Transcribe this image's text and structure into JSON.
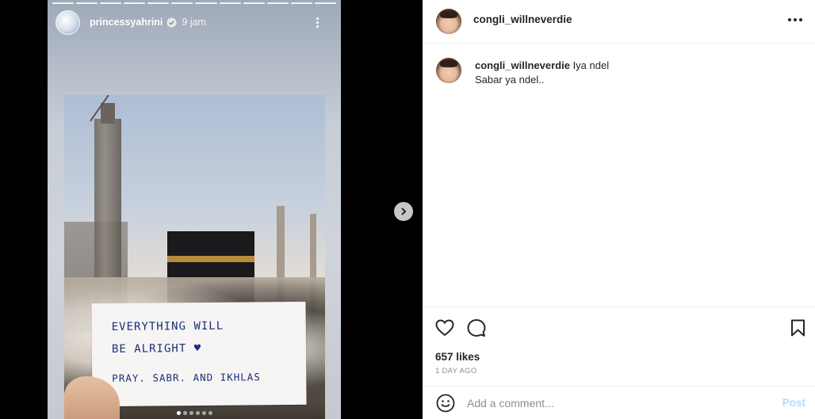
{
  "story": {
    "username": "princessyahrini",
    "time": "9 jam",
    "note_lines": [
      "EVERYTHING WILL",
      "BE ALRIGHT ♥",
      "PRAY. SABR. AND IKHLAS"
    ],
    "progress_count": 12,
    "dots_count": 6,
    "active_dot": 0
  },
  "post": {
    "username": "congli_willneverdie",
    "comment": {
      "username": "congli_willneverdie",
      "text": "Iya ndel",
      "line2": "Sabar ya ndel.."
    },
    "likes": "657 likes",
    "time_ago": "1 DAY AGO",
    "add_comment_placeholder": "Add a comment...",
    "post_label": "Post"
  },
  "colors": {
    "accent_post_disabled": "#b3dbff",
    "text_primary": "#262626",
    "text_secondary": "#8e8e8e"
  }
}
